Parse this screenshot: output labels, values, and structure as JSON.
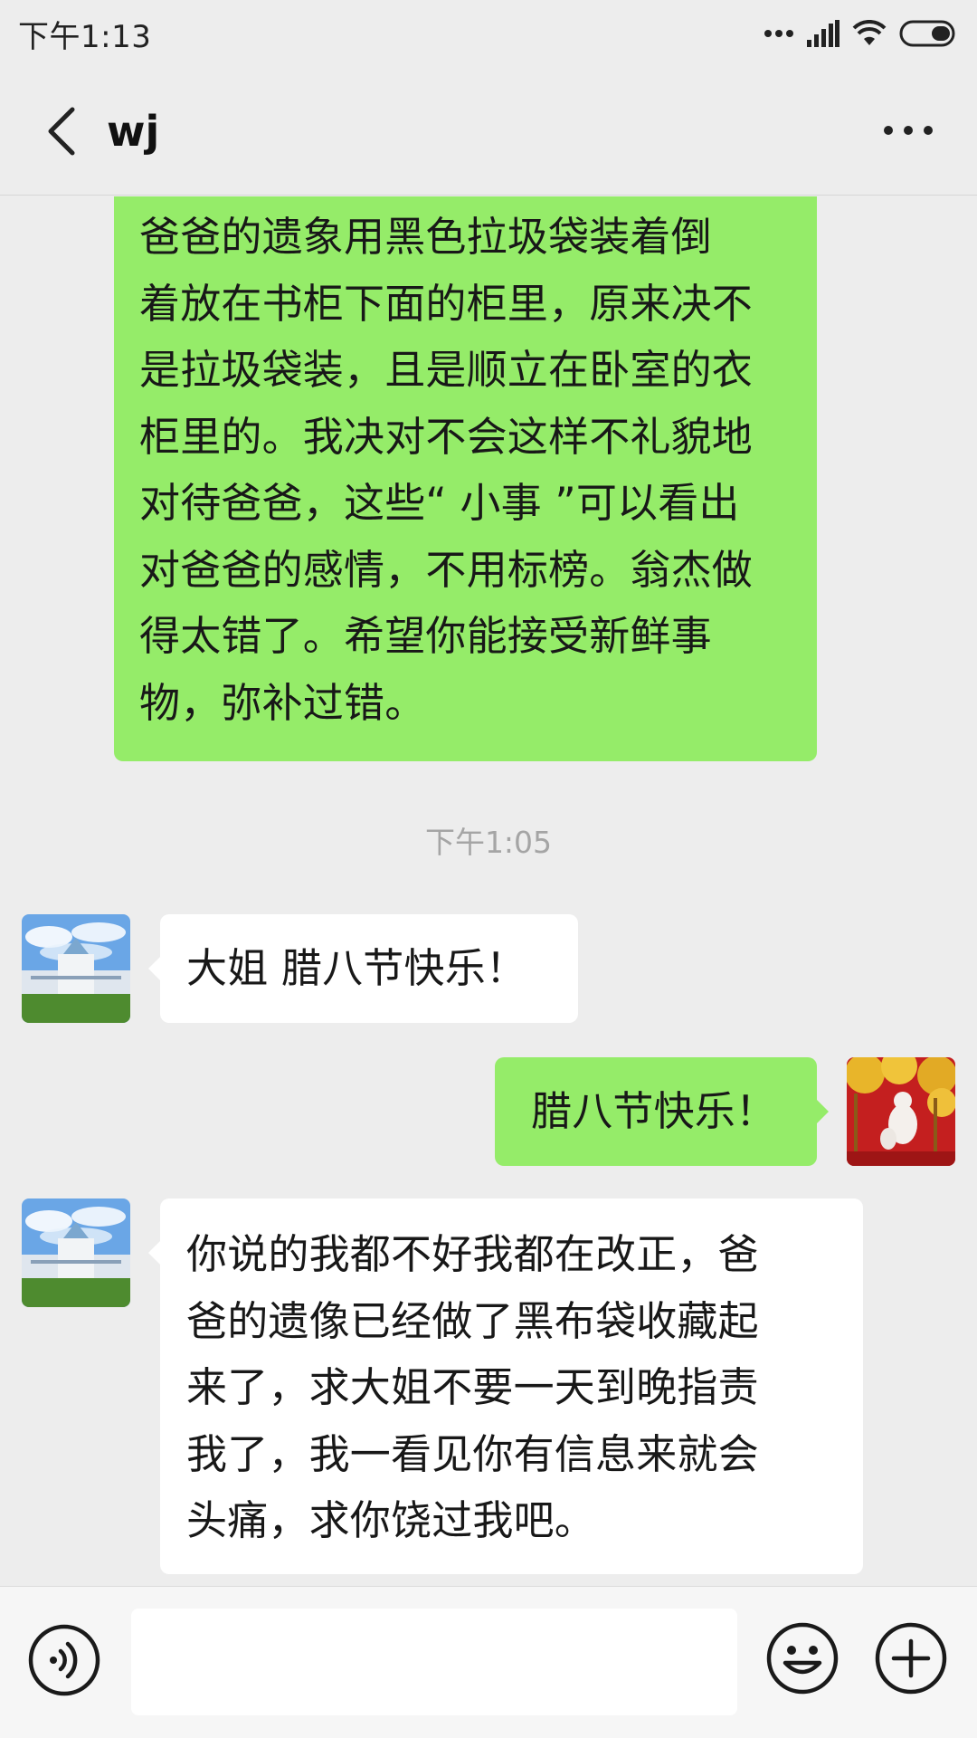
{
  "status_bar": {
    "time": "下午1:13",
    "icons": [
      "dots-icon",
      "signal-icon",
      "wifi-icon",
      "battery-icon"
    ]
  },
  "header": {
    "title": "wj",
    "back_icon": "chevron-left-icon",
    "more_icon": "more-dots-icon"
  },
  "messages": [
    {
      "direction": "sent",
      "lines": [
        "爸爸的遗象用黑色拉圾袋装着倒",
        "着放在书柜下面的柜里，原来决不",
        "是拉圾袋装，且是顺立在卧室的衣",
        "柜里的。我决对不会这样不礼貌地",
        "对待爸爸，这些“ 小事 ”可以看出",
        "对爸爸的感情，不用标榜。翁杰做",
        "得太错了。希望你能接受新鲜事",
        "物，弥补过错。"
      ]
    },
    {
      "type": "timestamp",
      "text": "下午1:05"
    },
    {
      "direction": "received",
      "lines": [
        "大姐 腊八节快乐！"
      ]
    },
    {
      "direction": "sent",
      "lines": [
        "腊八节快乐！"
      ]
    },
    {
      "direction": "received",
      "lines": [
        "你说的我都不好我都在改正，爸",
        "爸的遗像已经做了黑布袋收藏起",
        "来了，求大姐不要一天到晚指责",
        "我了，我一看见你有信息来就会",
        "头痛，求你饶过我吧。"
      ]
    }
  ],
  "input_bar": {
    "voice_icon": "voice-icon",
    "text_value": "",
    "emoji_icon": "emoji-icon",
    "plus_icon": "plus-icon"
  },
  "colors": {
    "background": "#ededed",
    "sent_bubble": "#95ec69",
    "received_bubble": "#ffffff",
    "timestamp": "#a5a5a5"
  }
}
